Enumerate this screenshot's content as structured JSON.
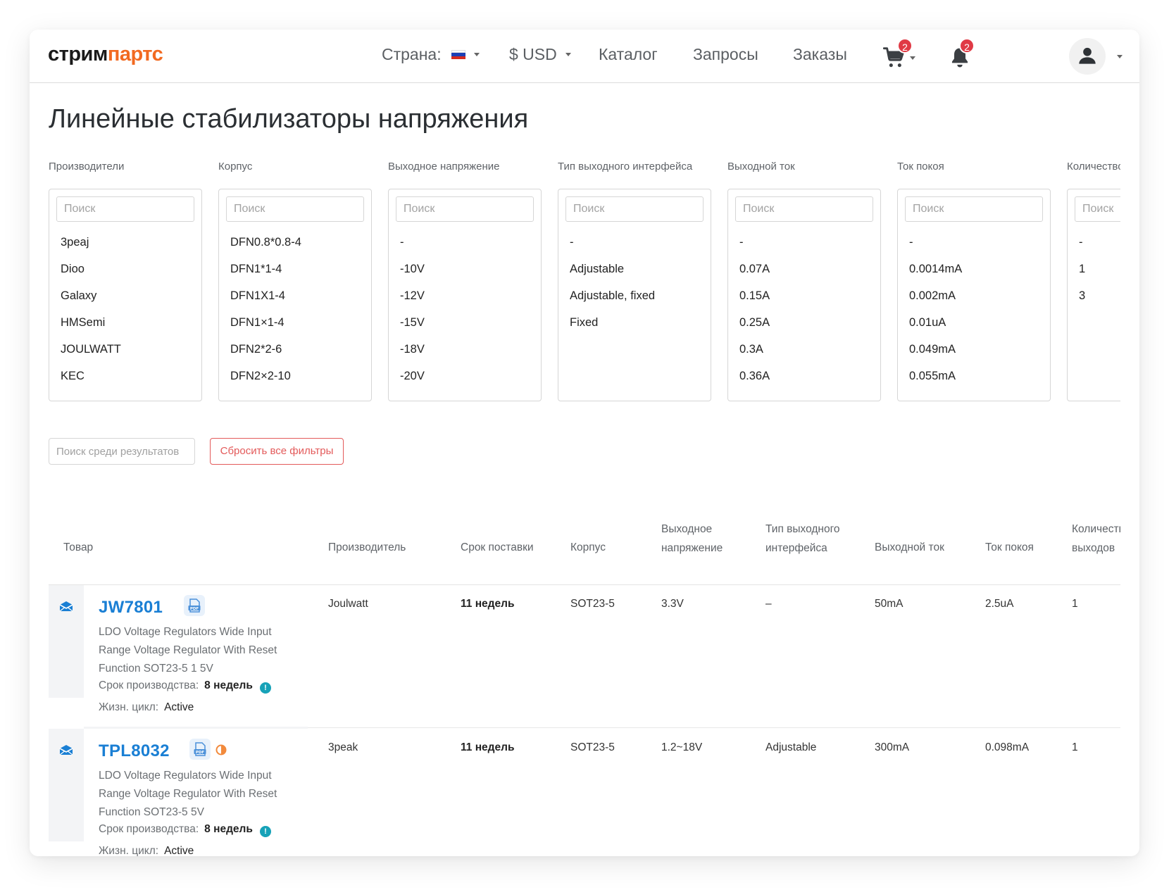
{
  "logo": {
    "part1": "стрим",
    "part2": "партс"
  },
  "header": {
    "country_label": "Страна:",
    "currency": "$ USD",
    "nav": [
      "Каталог",
      "Запросы",
      "Заказы"
    ],
    "cart_count": "2",
    "notif_count": "2",
    "cart_icon": "cart-icon",
    "bell_icon": "bell-icon",
    "user_icon": "user-icon"
  },
  "page_title": "Линейные стабилизаторы напряжения",
  "search_placeholder": "Поиск",
  "filters": [
    {
      "label": "Производители",
      "options": [
        "3peaj",
        "Dioo",
        "Galaxy",
        "HMSemi",
        "JOULWATT",
        "KEC"
      ]
    },
    {
      "label": "Корпус",
      "options": [
        "DFN0.8*0.8-4",
        "DFN1*1-4",
        "DFN1X1-4",
        "DFN1×1-4",
        "DFN2*2-6",
        "DFN2×2-10"
      ]
    },
    {
      "label": "Выходное напряжение",
      "options": [
        "-",
        "-10V",
        "-12V",
        "-15V",
        "-18V",
        "-20V"
      ]
    },
    {
      "label": "Тип выходного интерфейса",
      "options": [
        "-",
        "Adjustable",
        "Adjustable, fixed",
        "Fixed"
      ]
    },
    {
      "label": "Выходной ток",
      "options": [
        "-",
        "0.07A",
        "0.15A",
        "0.25A",
        "0.3A",
        "0.36A"
      ]
    },
    {
      "label": "Ток покоя",
      "options": [
        "-",
        "0.0014mA",
        "0.002mA",
        "0.01uA",
        "0.049mA",
        "0.055mA"
      ]
    },
    {
      "label": "Количество",
      "options": [
        "-",
        "1",
        "3"
      ]
    }
  ],
  "search_results_placeholder": "Поиск среди результатов",
  "reset_label": "Сбросить все фильтры",
  "table": {
    "headers": {
      "product": "Товар",
      "manufacturer": "Производитель",
      "lead_time": "Срок поставки",
      "package": "Корпус",
      "out_voltage_1": "Выходное",
      "out_voltage_2": "напряжение",
      "iface_1": "Тип выходного",
      "iface_2": "интерфейса",
      "out_current": "Выходной ток",
      "quiescent": "Ток покоя",
      "count_1": "Количество",
      "count_2": "выходов"
    },
    "prod_label": "Срок производства:",
    "life_label": "Жизн. цикл:",
    "rows": [
      {
        "name": "JW7801",
        "desc": "LDO Voltage Regulators Wide Input Range Voltage Regulator With Reset Function SOT23-5 1 5V",
        "prod_time": "8 недель",
        "lifecycle": "Active",
        "manufacturer": "Joulwatt",
        "lead_time": "11 недель",
        "package": "SOT23-5",
        "out_voltage": "3.3V",
        "iface": "–",
        "out_current": "50mA",
        "quiescent": "2.5uA",
        "count": "1"
      },
      {
        "name": "TPL8032",
        "desc": "LDO Voltage Regulators Wide Input Range Voltage Regulator With Reset Function SOT23-5 5V",
        "prod_time": "8 недель",
        "lifecycle": "Active",
        "manufacturer": "3peak",
        "lead_time": "11 недель",
        "package": "SOT23-5",
        "out_voltage": "1.2~18V",
        "iface": "Adjustable",
        "out_current": "300mA",
        "quiescent": "0.098mA",
        "count": "1"
      }
    ]
  },
  "colors": {
    "accent": "#f26a21",
    "link": "#1a7fd4",
    "badge": "#e03a45",
    "danger": "#e35a5a",
    "info": "#17a2b8"
  }
}
